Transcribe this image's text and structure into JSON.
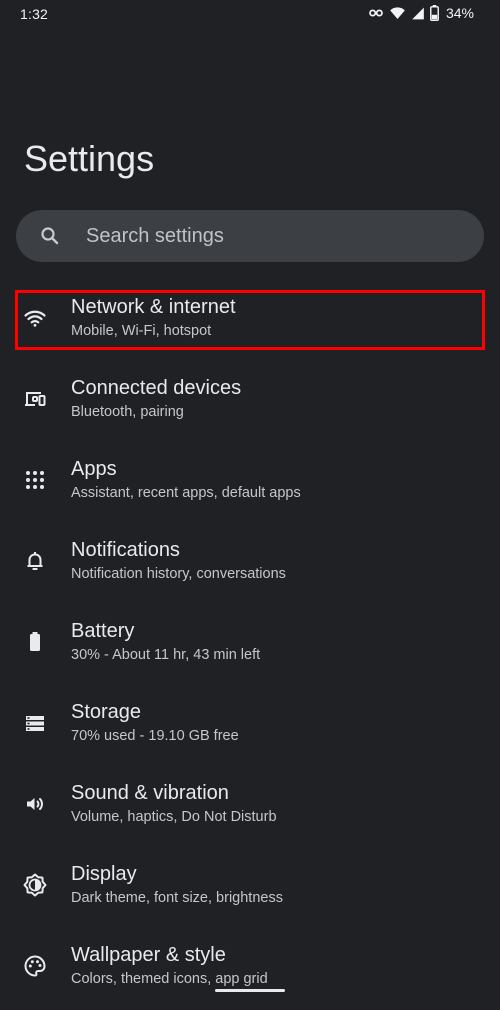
{
  "status_bar": {
    "time": "1:32",
    "battery_percent": "34%",
    "icons": [
      "vpn-key-icon",
      "wifi-signal-icon",
      "cell-signal-icon",
      "battery-icon"
    ],
    "battery_level": 0.34
  },
  "page": {
    "title": "Settings"
  },
  "search": {
    "placeholder": "Search settings"
  },
  "settings": {
    "items": [
      {
        "title": "Network & internet",
        "subtitle": "Mobile, Wi-Fi, hotspot",
        "icon": "wifi-icon",
        "highlighted": true
      },
      {
        "title": "Connected devices",
        "subtitle": "Bluetooth, pairing",
        "icon": "devices-icon"
      },
      {
        "title": "Apps",
        "subtitle": "Assistant, recent apps, default apps",
        "icon": "apps-grid-icon"
      },
      {
        "title": "Notifications",
        "subtitle": "Notification history, conversations",
        "icon": "bell-icon"
      },
      {
        "title": "Battery",
        "subtitle": "30% - About 11 hr, 43 min left",
        "icon": "battery-icon"
      },
      {
        "title": "Storage",
        "subtitle": "70% used - 19.10 GB free",
        "icon": "storage-icon"
      },
      {
        "title": "Sound & vibration",
        "subtitle": "Volume, haptics, Do Not Disturb",
        "icon": "speaker-icon"
      },
      {
        "title": "Display",
        "subtitle": "Dark theme, font size, brightness",
        "icon": "brightness-icon"
      },
      {
        "title": "Wallpaper & style",
        "subtitle": "Colors, themed icons, app grid",
        "icon": "palette-icon"
      }
    ]
  },
  "colors": {
    "background": "#1f2124",
    "search_background": "#3c3f43",
    "primary_text": "#e8eaed",
    "secondary_text": "#c4c7cb",
    "highlight": "#ff0000"
  }
}
